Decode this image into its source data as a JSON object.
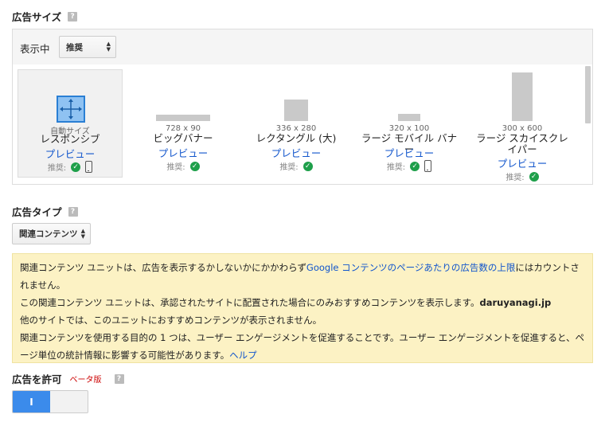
{
  "ad_size": {
    "title": "広告サイズ",
    "show_label": "表示中",
    "filter_value": "推奨",
    "cards": [
      {
        "dim": "自動サイズ",
        "name": "レスポンシブ",
        "preview": "プレビュー",
        "rec_label": "推奨:",
        "mobile": true
      },
      {
        "dim": "728 x 90",
        "name": "ビッグバナー",
        "preview": "プレビュー",
        "rec_label": "推奨:",
        "mobile": false
      },
      {
        "dim": "336 x 280",
        "name": "レクタングル (大)",
        "preview": "プレビュー",
        "rec_label": "推奨:",
        "mobile": false
      },
      {
        "dim": "320 x 100",
        "name": "ラージ モバイル バナー",
        "preview": "プレビュー",
        "rec_label": "推奨:",
        "mobile": true
      },
      {
        "dim": "300 x 600",
        "name": "ラージ スカイスクレイパー",
        "preview": "プレビュー",
        "rec_label": "推奨:",
        "mobile": false
      }
    ]
  },
  "ad_type": {
    "title": "広告タイプ",
    "value": "関連コンテンツ"
  },
  "info": {
    "line1_a": "関連コンテンツ ユニットは、広告を表示するかしないかにかかわらず",
    "line1_link": "Google コンテンツのページあたりの広告数の上限",
    "line1_b": "にはカウントされません。",
    "line2_a": "この関連コンテンツ ユニットは、承認されたサイトに配置された場合にのみおすすめコンテンツを表示します。",
    "line2_site": "daruyanagi.jp",
    "line3": "他のサイトでは、このユニットにおすすめコンテンツが表示されません。",
    "line4": "関連コンテンツを使用する目的の 1 つは、ユーザー エンゲージメントを促進することです。ユーザー エンゲージメントを促進すると、ページ単位の統計情報に影響する可能性があります。",
    "line4_link": "ヘルプ"
  },
  "allow_ads": {
    "title": "広告を許可",
    "beta": "ベータ版",
    "toggle_on": "I"
  },
  "colors": {
    "accent": "#3b8beb",
    "link": "#1155cc",
    "check": "#1e9f4a",
    "info_bg": "#fcf2c4"
  }
}
